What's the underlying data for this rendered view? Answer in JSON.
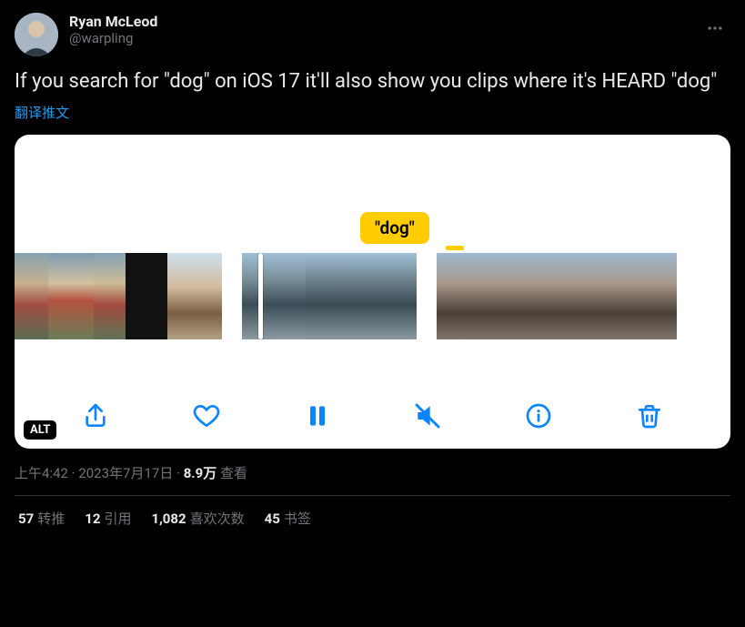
{
  "author": {
    "display_name": "Ryan McLeod",
    "handle": "@warpling"
  },
  "tweet": {
    "text": "If you search for \"dog\" on iOS 17 it'll also show you clips where it's HEARD \"dog\"",
    "translate_label": "翻译推文"
  },
  "media": {
    "tooltip_text": "\"dog\"",
    "alt_badge": "ALT"
  },
  "meta": {
    "time": "上午4:42",
    "date": "2023年7月17日",
    "views_count": "8.9万",
    "views_label": "查看",
    "separator": " · "
  },
  "stats": {
    "retweets_count": "57",
    "retweets_label": "转推",
    "quotes_count": "12",
    "quotes_label": "引用",
    "likes_count": "1,082",
    "likes_label": "喜欢次数",
    "bookmarks_count": "45",
    "bookmarks_label": "书签"
  }
}
